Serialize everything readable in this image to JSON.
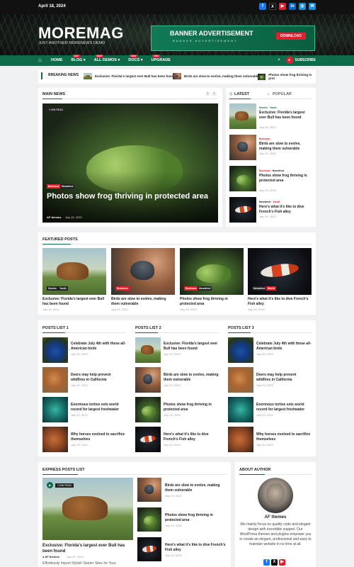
{
  "topbar": {
    "date": "April 18, 2024",
    "social": [
      "f",
      "X",
      "▶",
      "in",
      "◎",
      "✉"
    ]
  },
  "header": {
    "logo": "MOREMAG",
    "tagline": "JUST ANOTHER MORENEWS DEMO",
    "banner": {
      "title": "BANNER ADVERTISEMENT",
      "subtitle": "BANNER ADVERTISEMENT",
      "button": "DOWNLOAD"
    }
  },
  "nav": {
    "items": [
      "HOME",
      "BLOG",
      "ALL DEMOS",
      "DOCS",
      "UPGRADE"
    ],
    "badges": [
      "",
      "HOT",
      "NEW",
      "NEW",
      "PRO"
    ],
    "subscribe": "SUBSCRIBE"
  },
  "breaking": {
    "label": "BREAKING NEWS",
    "items": [
      "Exclusive: Florida's largest ever Bull has been found",
      "Birds are slow to evolve, making them vulnerable",
      "Photos show frog thriving in prot"
    ]
  },
  "main_news": {
    "label": "MAIN NEWS",
    "pill": "1 MIN READ",
    "tags": [
      "Business",
      "Newsfeed"
    ],
    "title": "Photos show frog thriving in protected area",
    "author": "AF themes",
    "date": "July 20, 2022"
  },
  "latest": {
    "tab_latest": "LATEST",
    "tab_popular": "POPULAR",
    "items": [
      {
        "tags": [
          "Stories",
          "Youth"
        ],
        "title": "Exclusive: Florida's largest ever Bull has been found",
        "date": "July 20, 2022"
      },
      {
        "tags": [
          "Business"
        ],
        "title": "Birds are slow to evolve, making them vulnerable",
        "date": "July 20, 2022"
      },
      {
        "tags": [
          "Business",
          "Newsfeed"
        ],
        "title": "Photos show frog thriving in protected area",
        "date": "July 20, 2022"
      },
      {
        "tags": [
          "Newsfeed",
          "World"
        ],
        "title": "Here's what it's like to dive French's Fish alley",
        "date": "July 20, 2022"
      }
    ]
  },
  "featured": {
    "label": "FEATURED POSTS",
    "items": [
      {
        "tags": [
          "Stories",
          "Youth"
        ],
        "title": "Exclusive: Florida's largest ever Bull has been found",
        "date": "July 20, 2022"
      },
      {
        "tags": [
          "Business"
        ],
        "title": "Birds are slow to evolve, making them vulnerable",
        "date": "July 20, 2022"
      },
      {
        "tags": [
          "Business",
          "Newsfeed"
        ],
        "title": "Photos show frog thriving in protected area",
        "date": "July 20, 2022"
      },
      {
        "tags": [
          "Newsfeed",
          "World"
        ],
        "title": "Here's what it's like to dive French's Fish alley",
        "date": "July 20, 2022"
      }
    ]
  },
  "posts_lists": [
    {
      "label": "POSTS LIST 1",
      "items": [
        {
          "title": "Celebrate July 4th with these all-American birds",
          "date": "July 20, 2022"
        },
        {
          "title": "Deers may help prevent wildfires in California",
          "date": "July 20, 2022"
        },
        {
          "title": "Enormous tortise sets world record for largest freshwater",
          "date": "July 20, 2022"
        },
        {
          "title": "Why horses evolved to sacrifice themselves",
          "date": "July 20, 2022"
        }
      ]
    },
    {
      "label": "POSTS LIST 2",
      "items": [
        {
          "title": "Exclusive: Florida's largest ever Bull has been found",
          "date": "July 20, 2022"
        },
        {
          "title": "Birds are slow to evolve, making them vulnerable",
          "date": "July 20, 2022"
        },
        {
          "title": "Photos show frog thriving in protected area",
          "date": "July 20, 2022"
        },
        {
          "title": "Here's what it's like to dive French's Fish alley",
          "date": "July 20, 2022"
        }
      ]
    },
    {
      "label": "POSTS LIST 3",
      "items": [
        {
          "title": "Celebrate July 4th with these all-American birds",
          "date": "July 20, 2022"
        },
        {
          "title": "Deers may help prevent wildfires in California",
          "date": "July 20, 2022"
        },
        {
          "title": "Enormous tortise sets world record for largest freshwater",
          "date": "July 20, 2022"
        },
        {
          "title": "Why horses evolved to sacrifice themselves",
          "date": "July 20, 2022"
        }
      ]
    }
  ],
  "express": {
    "label": "EXPRESS POSTS LIST",
    "pill": "1 MIN READ",
    "main": {
      "title": "Exclusive: Florida's largest ever Bull has been found",
      "author": "AF themes",
      "date": "July 20, 2022",
      "excerpt": "Effortlessly Import Stylish Starter Sites for Your"
    },
    "items": [
      {
        "title": "Birds are slow to evolve, making them vulnerable",
        "date": "July 20, 2022"
      },
      {
        "title": "Photos show frog thriving in protected area",
        "date": "July 20, 2022"
      },
      {
        "title": "Here's what it's like to dive French's Fish alley",
        "date": "July 20, 2022"
      }
    ]
  },
  "about": {
    "label": "ABOUT AUTHOR",
    "name": "AF themes",
    "bio": "We mainly focus on quality code and elegant design with incredible support. Our WordPress themes and plugins empower you to create an elegant, professional and easy to maintain website in no time at all."
  },
  "colors": {
    "accent": "#0e6b4a",
    "red": "#e0202c",
    "dark": "#111111"
  }
}
